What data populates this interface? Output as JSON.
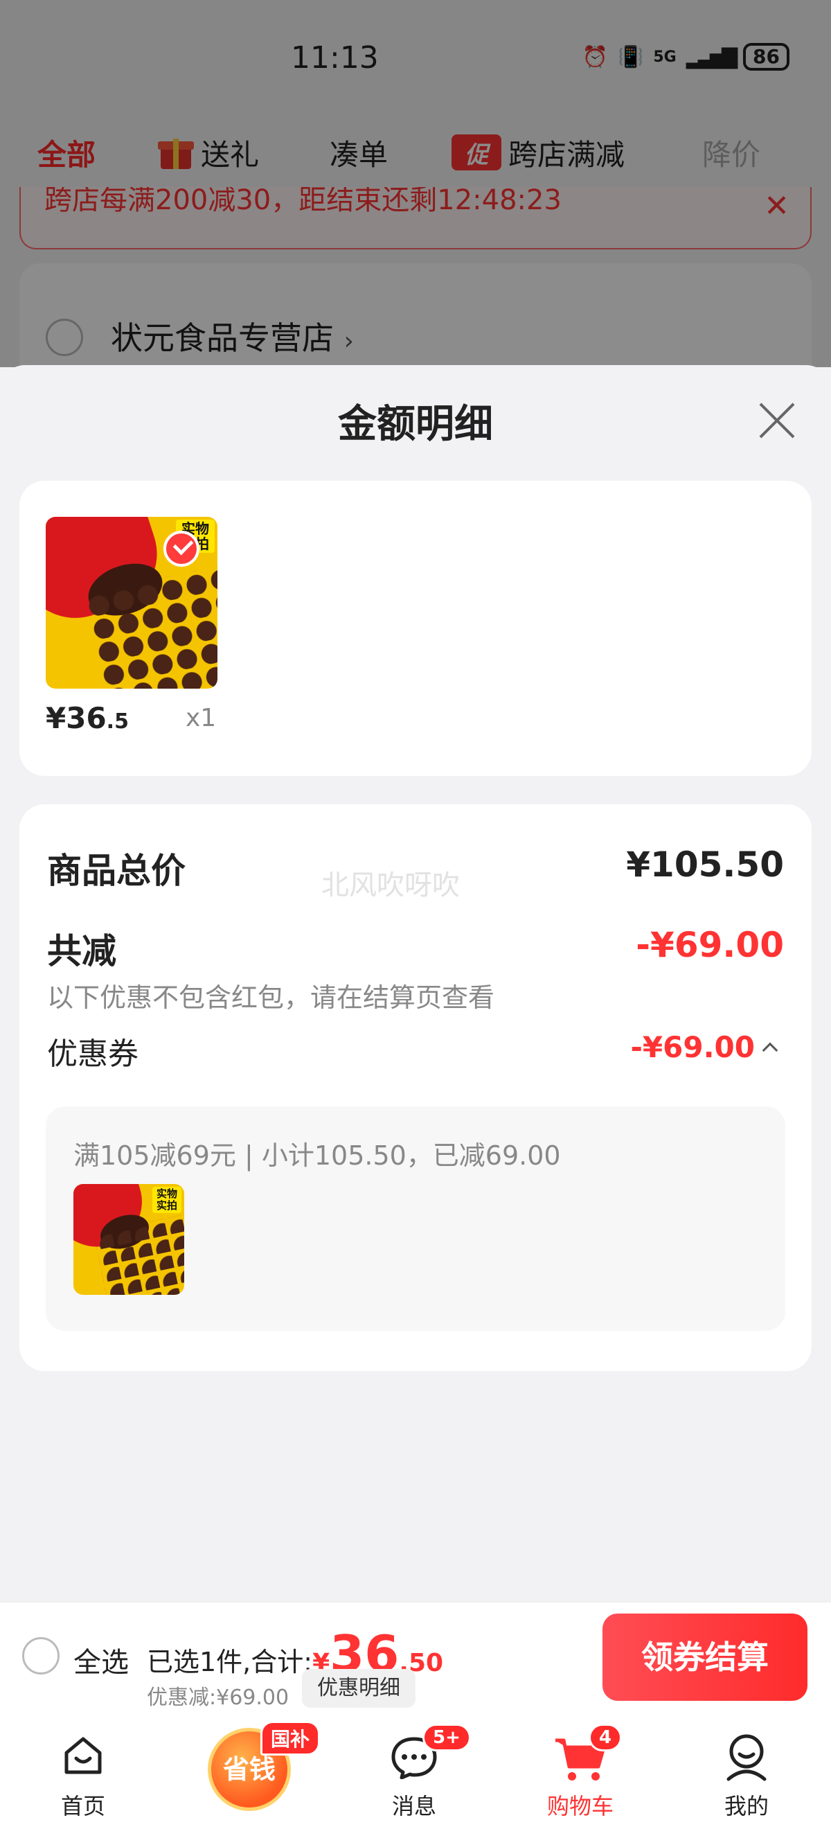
{
  "status_bar": {
    "time": "11:13",
    "network": "5G",
    "battery": "86"
  },
  "tabs": [
    {
      "label": "全部"
    },
    {
      "label": "送礼",
      "icon": "gift-icon"
    },
    {
      "label": "凑单"
    },
    {
      "label": "跨店满减",
      "badge": "促"
    },
    {
      "label": "降价"
    }
  ],
  "promo_bar": {
    "text": "跨店每满200减30，距结束还剩12:48:23"
  },
  "store": {
    "name": "状元食品专营店"
  },
  "sheet": {
    "title": "金额明细",
    "item": {
      "price_int": "¥36",
      "price_dec": ".5",
      "qty": "x1",
      "stamp": "实物实拍"
    },
    "watermark": "北风吹呀吹",
    "total_label": "商品总价",
    "total_value": "¥105.50",
    "discount_label": "共减",
    "discount_value": "-¥69.00",
    "discount_note": "以下优惠不包含红包，请在结算页查看",
    "coupon_label": "优惠券",
    "coupon_value": "-¥69.00",
    "coupon_desc": "满105减69元 | 小计105.50，已减69.00"
  },
  "checkout": {
    "select_all": "全选",
    "selected_prefix": "已选1件,合计:",
    "yen": "¥",
    "amount_int": "36",
    "amount_dec": ".50",
    "saved": "优惠减:¥69.00",
    "detail_button": "优惠明细",
    "pay_button": "领券结算"
  },
  "tabbar": {
    "home": "首页",
    "save_money": "省钱",
    "gov_badge": "国补",
    "messages": "消息",
    "messages_badge": "5+",
    "cart": "购物车",
    "cart_badge": "4",
    "me": "我的"
  },
  "colors": {
    "accent": "#ff3333",
    "overlay": "rgba(0,0,0,0.45)",
    "background": "#f2f2f4"
  }
}
